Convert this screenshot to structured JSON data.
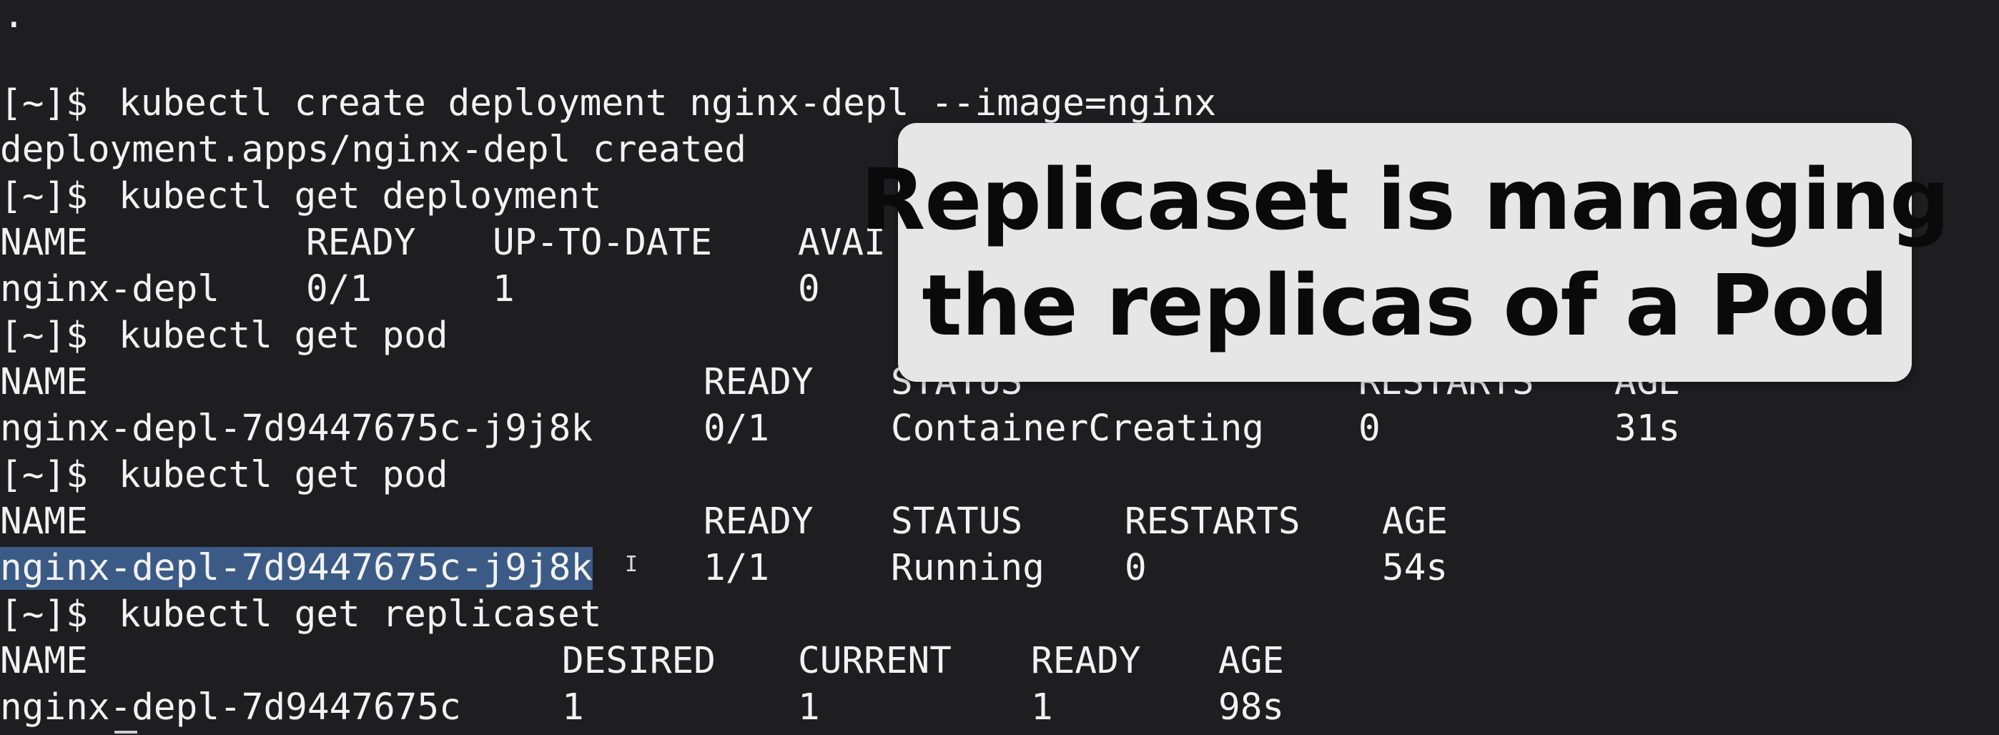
{
  "terminal": {
    "top_dot": ".",
    "prompt": "[~]$",
    "lines": {
      "cmd1": "kubectl create deployment nginx-depl --image=nginx",
      "out1": "deployment.apps/nginx-depl created",
      "cmd2": "kubectl get deployment",
      "cmd3": "kubectl get pod",
      "cmd4": "kubectl get pod",
      "cmd5": "kubectl get replicaset"
    },
    "deployment_table": {
      "headers": [
        "NAME",
        "READY",
        "UP-TO-DATE",
        "AVAI"
      ],
      "row": [
        "nginx-depl",
        "0/1",
        "1",
        "0"
      ]
    },
    "pod_table_1": {
      "headers": [
        "NAME",
        "READY",
        "STATUS",
        "RESTARTS",
        "AGE"
      ],
      "row": [
        "nginx-depl-7d9447675c-j9j8k",
        "0/1",
        "ContainerCreating",
        "0",
        "31s"
      ]
    },
    "pod_table_2": {
      "headers": [
        "NAME",
        "READY",
        "STATUS",
        "RESTARTS",
        "AGE"
      ],
      "row": [
        "nginx-depl-7d9447675c-j9j8k",
        "1/1",
        "Running",
        "0",
        "54s"
      ]
    },
    "replicaset_table": {
      "headers": [
        "NAME",
        "DESIRED",
        "CURRENT",
        "READY",
        "AGE"
      ],
      "row": [
        "nginx-depl-7d9447675c",
        "1",
        "1",
        "1",
        "98s"
      ]
    },
    "text_cursor_glyph": "I"
  },
  "overlay": {
    "line1": "Replicaset is managing",
    "line2": "the replicas of a Pod"
  },
  "colors": {
    "background": "#1e1e20",
    "text": "#f2f2f2",
    "selection": "#3b5b86",
    "overlay_bg": "#e6e6e6",
    "overlay_text": "#0a0a0a"
  }
}
